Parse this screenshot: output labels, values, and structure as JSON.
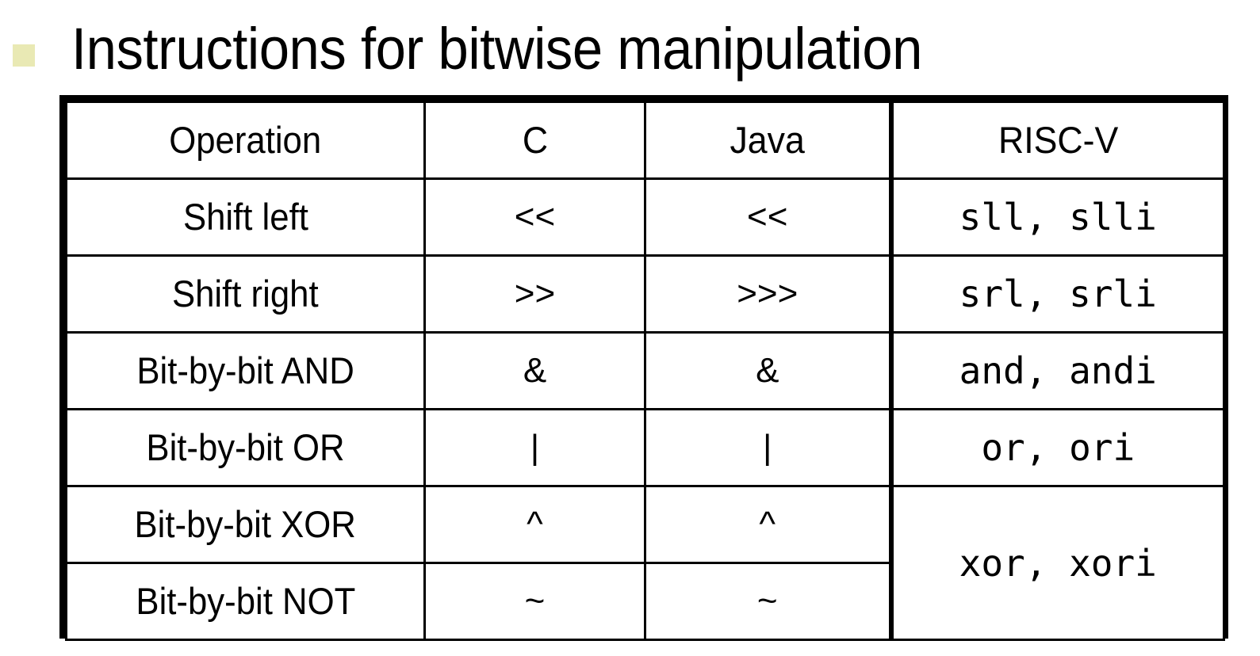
{
  "slide": {
    "bullet_color": "#E9E9B4",
    "title": "Instructions for bitwise manipulation"
  },
  "table": {
    "headers": {
      "operation": "Operation",
      "c": "C",
      "java": "Java",
      "riscv": "RISC-V"
    },
    "rows": [
      {
        "operation": "Shift left",
        "c": "<<",
        "java": "<<",
        "riscv": "sll, slli",
        "riscv_rowspan": 1
      },
      {
        "operation": "Shift right",
        "c": ">>",
        "java": ">>>",
        "riscv": "srl, srli",
        "riscv_rowspan": 1
      },
      {
        "operation": "Bit-by-bit AND",
        "c": "&",
        "java": "&",
        "riscv": "and, andi",
        "riscv_rowspan": 1
      },
      {
        "operation": "Bit-by-bit OR",
        "c": "|",
        "java": "|",
        "riscv": "or, ori",
        "riscv_rowspan": 1
      },
      {
        "operation": "Bit-by-bit XOR",
        "c": "^",
        "java": "^",
        "riscv": "xor, xori",
        "riscv_rowspan": 2
      },
      {
        "operation": "Bit-by-bit NOT",
        "c": "~",
        "java": "~",
        "riscv": null,
        "riscv_rowspan": 0
      }
    ]
  }
}
